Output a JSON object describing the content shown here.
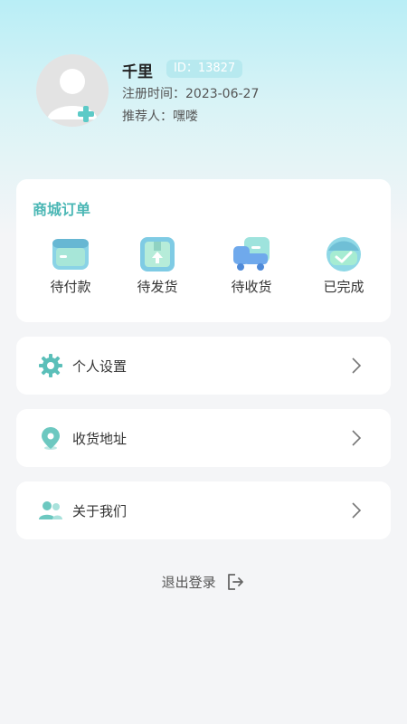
{
  "profile": {
    "name": "千里",
    "id_text": "ID：13827",
    "register_text": "注册时间：2023-06-27",
    "referrer_text": "推荐人：嘿喽"
  },
  "orders": {
    "title": "商城订单",
    "items": [
      {
        "label": "待付款",
        "icon": "wallet-icon"
      },
      {
        "label": "待发货",
        "icon": "package-icon"
      },
      {
        "label": "待收货",
        "icon": "truck-icon"
      },
      {
        "label": "已完成",
        "icon": "check-icon"
      }
    ]
  },
  "menu": [
    {
      "label": "个人设置",
      "icon": "gear-icon"
    },
    {
      "label": "收货地址",
      "icon": "location-pin-icon"
    },
    {
      "label": "关于我们",
      "icon": "users-icon"
    }
  ],
  "logout_label": "退出登录",
  "colors": {
    "accent": "#4bb7b5",
    "badge_bg": "#b7e9ef"
  }
}
